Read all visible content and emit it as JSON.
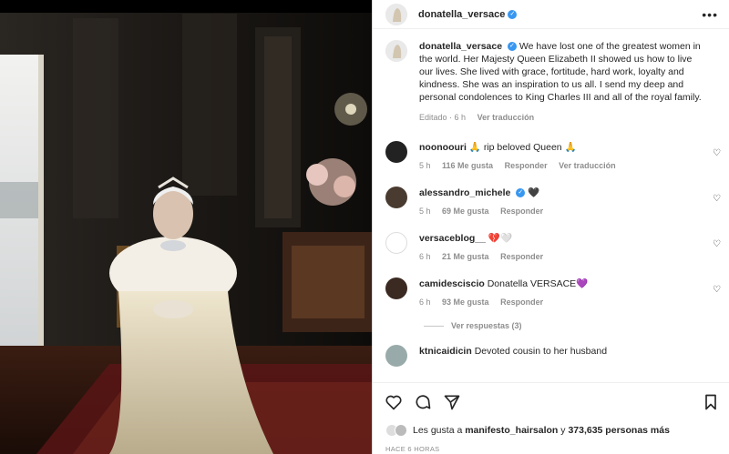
{
  "header": {
    "username": "donatella_versace",
    "more_label": "•••"
  },
  "caption": {
    "username": "donatella_versace",
    "text": "We have lost one of the greatest women in the world. Her Majesty Queen Elizabeth II showed us how to live our lives. She lived with grace, fortitude, hard work, loyalty and kindness. She was an inspiration to us all. I send my deep and personal condolences to King Charles III and all of the royal family.",
    "edited": "Editado · 6 h",
    "see_translation": "Ver traducción"
  },
  "comments": [
    {
      "username": "noonoouri",
      "text": "🙏 rip beloved Queen 🙏",
      "time": "5 h",
      "likes": "116 Me gusta",
      "reply": "Responder",
      "translate": "Ver traducción"
    },
    {
      "username": "alessandro_michele",
      "text": "🖤",
      "time": "5 h",
      "likes": "69 Me gusta",
      "reply": "Responder"
    },
    {
      "username": "versaceblog__",
      "text": "💔🤍",
      "time": "6 h",
      "likes": "21 Me gusta",
      "reply": "Responder"
    },
    {
      "username": "camidesciscio",
      "text": "Donatella VERSACE💜",
      "time": "6 h",
      "likes": "93 Me gusta",
      "reply": "Responder"
    },
    {
      "username": "ktnicaidicin",
      "text": "Devoted cousin to her husband"
    }
  ],
  "view_replies": "Ver respuestas (3)",
  "likes_line": {
    "prefix": "Les gusta a",
    "user": "manifesto_hairsalon",
    "middle": "y",
    "count": "373,635 personas más"
  },
  "timestamp": "HACE 6 HORAS",
  "icons": {
    "verified": "verified-badge-icon",
    "like": "heart-icon",
    "comment": "comment-icon",
    "share": "send-icon",
    "save": "bookmark-icon"
  },
  "colors": {
    "verified": "#3897f0",
    "muted": "#8e8e8e",
    "text": "#262626"
  }
}
